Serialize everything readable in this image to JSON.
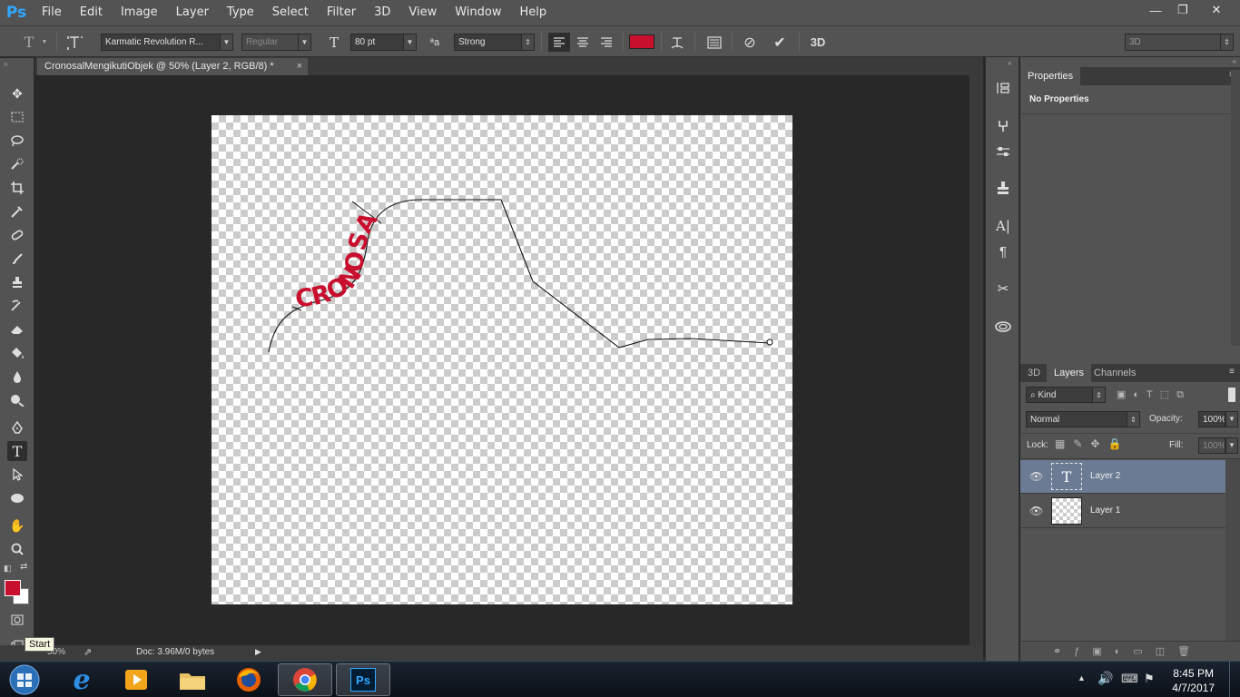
{
  "app": {
    "logo": "Ps"
  },
  "menu": [
    "File",
    "Edit",
    "Image",
    "Layer",
    "Type",
    "Select",
    "Filter",
    "3D",
    "View",
    "Window",
    "Help"
  ],
  "window_controls": {
    "minimize": "—",
    "restore": "❐",
    "close": "✕"
  },
  "options": {
    "tool_glyph": "T",
    "font_family": "Karmatic Revolution R...",
    "font_style": "Regular",
    "font_size": "80 pt",
    "aa_icon_text": "ªa",
    "anti_alias": "Strong",
    "text_color": "#c8102e",
    "workspace": "3D",
    "three_d_label": "3D"
  },
  "document": {
    "tab_title": "CronosalMengikutiObjek @ 50% (Layer 2, RGB/8) *",
    "tab_close": "×",
    "path_text": "CRONOSAL",
    "path_text_color": "#c8102e"
  },
  "status": {
    "zoom": "50%",
    "doc": "Doc: 3.96M/0 bytes"
  },
  "tooltip": "Start",
  "properties": {
    "tab": "Properties",
    "message": "No Properties"
  },
  "layers_panel": {
    "tabs": [
      "3D",
      "Layers",
      "Channels"
    ],
    "active_tab": "Layers",
    "filter_kind": "Kind",
    "blend_mode": "Normal",
    "opacity_label": "Opacity:",
    "opacity": "100%",
    "lock_label": "Lock:",
    "fill_label": "Fill:",
    "fill": "100%",
    "layers": [
      {
        "name": "Layer 2",
        "type": "text",
        "selected": true,
        "thumb_glyph": "T"
      },
      {
        "name": "Layer 1",
        "type": "raster",
        "selected": false
      }
    ]
  },
  "taskbar": {
    "time": "8:45 PM",
    "date": "4/7/2017",
    "active_app_label": "Ps"
  }
}
